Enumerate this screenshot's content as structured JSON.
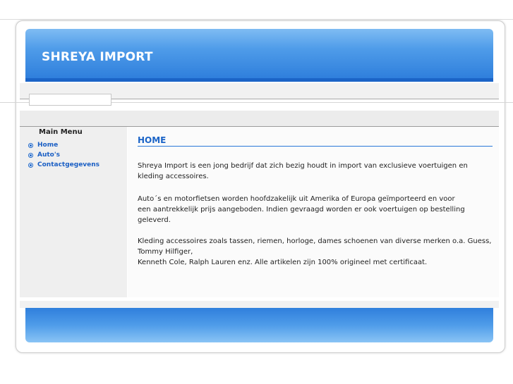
{
  "site": {
    "title": "SHREYA IMPORT"
  },
  "sidebar": {
    "title": "Main Menu",
    "items": [
      {
        "label": "Home"
      },
      {
        "label": "Auto's"
      },
      {
        "label": "Contactgegevens"
      }
    ]
  },
  "main": {
    "heading": "HOME",
    "paragraphs": [
      {
        "lines": [
          "Shreya Import is een jong bedrijf dat zich bezig houdt in import van exclusieve voertuigen en kleding accessoires."
        ]
      },
      {
        "lines": [
          "Auto´s en motorfietsen worden hoofdzakelijk uit Amerika of Europa geïmporteerd en voor",
          "een aantrekkelijk prijs aangeboden. Indien gevraagd worden er ook voertuigen op bestelling geleverd."
        ]
      },
      {
        "lines": [
          "Kleding accessoires zoals tassen, riemen, horloge, dames schoenen van diverse merken o.a. Guess, Tommy Hilfiger,",
          "Kenneth Cole, Ralph Lauren enz. Alle artikelen zijn 100% origineel met certificaat."
        ]
      }
    ]
  },
  "colors": {
    "accent": "#1b64c7",
    "header_light": "#7fbcf3",
    "header_dark": "#2f7fdc"
  }
}
